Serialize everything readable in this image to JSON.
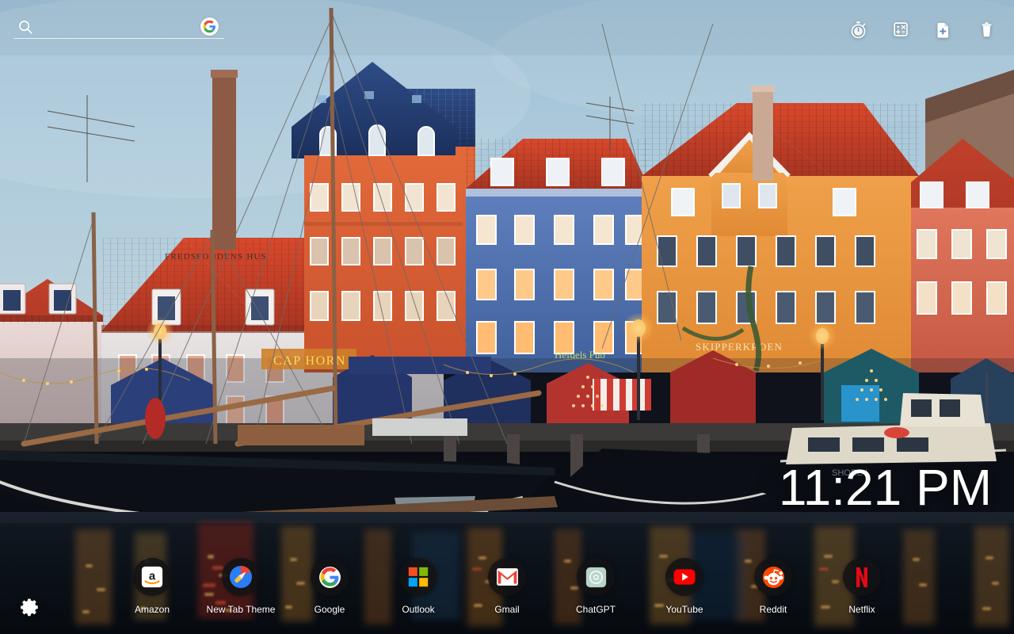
{
  "search": {
    "placeholder": "",
    "value": "",
    "icon": "search-icon",
    "engine_logo": "google-g-icon",
    "engine_name": "Google"
  },
  "toolbar": {
    "items": [
      {
        "name": "stopwatch-icon",
        "label": "Stopwatch"
      },
      {
        "name": "calculator-icon",
        "label": "Calculator"
      },
      {
        "name": "add-note-icon",
        "label": "Add Note"
      },
      {
        "name": "trash-icon",
        "label": "Trash"
      }
    ]
  },
  "clock": {
    "time": "11:21 PM"
  },
  "dock": {
    "shortcuts": [
      {
        "label": "Amazon",
        "icon": "amazon-icon"
      },
      {
        "label": "New Tab Theme",
        "icon": "new-tab-theme-icon"
      },
      {
        "label": "Google",
        "icon": "google-icon"
      },
      {
        "label": "Outlook",
        "icon": "outlook-icon"
      },
      {
        "label": "Gmail",
        "icon": "gmail-icon"
      },
      {
        "label": "ChatGPT",
        "icon": "chatgpt-icon"
      },
      {
        "label": "YouTube",
        "icon": "youtube-icon"
      },
      {
        "label": "Reddit",
        "icon": "reddit-icon"
      },
      {
        "label": "Netflix",
        "icon": "netflix-icon"
      }
    ]
  },
  "settings": {
    "label": "Settings",
    "icon": "gear-icon"
  },
  "wallpaper": {
    "scene": "Nyhavn harbour, Copenhagen at dusk with Christmas market",
    "signs": [
      "FREDSFONDENS HUS",
      "CAP HORN",
      "SKIPPERKROEN",
      "Hefdels Pub"
    ],
    "sky_color": "#a9c6da",
    "water_color": "#10161f",
    "accent_colors": [
      "#d94f2b",
      "#e8833a",
      "#3f63ad",
      "#c0392b",
      "#2b4d86"
    ]
  }
}
